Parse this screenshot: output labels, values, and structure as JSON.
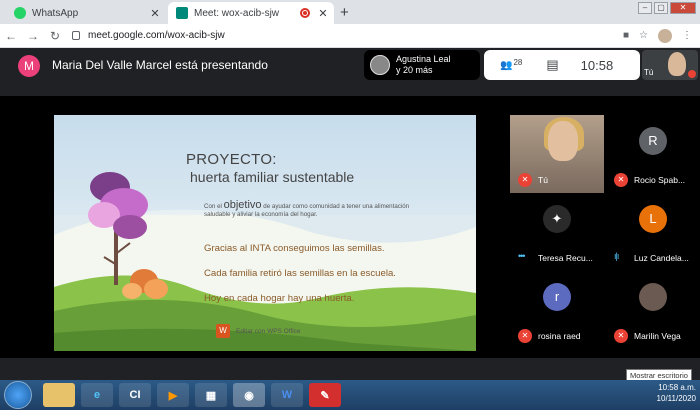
{
  "browser": {
    "tabs": [
      {
        "label": "WhatsApp",
        "favicon_color": "#25d366"
      },
      {
        "label": "Meet: wox-acib-sjw",
        "favicon_color": "#00897b"
      }
    ],
    "url": "meet.google.com/wox-acib-sjw"
  },
  "meet": {
    "presenter_initial": "M",
    "presenter_text": "Maria Del Valle Marcel está presentando",
    "pinned_name": "Agustina Leal",
    "pinned_more": "y 20 más",
    "people_count": "28",
    "clock": "10:58",
    "self_label": "Tú"
  },
  "slide": {
    "title_line1": "PROYECTO:",
    "title_line2": "huerta familiar sustentable",
    "intro_prefix": "Con el",
    "intro_emph": "objetivo",
    "intro_rest": "de ayudar como comunidad a tener una alimentación saludable y aliviar la economía del hogar.",
    "lines": [
      "Gracias al INTA conseguimos las semillas.",
      "Cada familia retiró las semillas en la escuela.",
      "Hoy en cada hogar hay una huerta."
    ],
    "footer": "Editar con WPS Office"
  },
  "participants": [
    {
      "name": "Tú",
      "initial": "",
      "color": "",
      "video": true,
      "muted": true
    },
    {
      "name": "Rocio Spab...",
      "initial": "R",
      "color": "#5f6368",
      "video": false,
      "muted": true
    },
    {
      "name": "Teresa Recu...",
      "initial": "",
      "color": "#3c4043",
      "video": false,
      "muted": false
    },
    {
      "name": "Luz Candela...",
      "initial": "L",
      "color": "#e8710a",
      "video": false,
      "muted": false
    },
    {
      "name": "rosina raed",
      "initial": "r",
      "color": "#5c6bc0",
      "video": false,
      "muted": true
    },
    {
      "name": "Marilin Vega",
      "initial": "",
      "color": "#6b5a52",
      "video": false,
      "muted": true
    }
  ],
  "taskbar": {
    "tooltip": "Mostrar escritorio",
    "time": "10:58 a.m.",
    "date": "10/11/2020"
  }
}
